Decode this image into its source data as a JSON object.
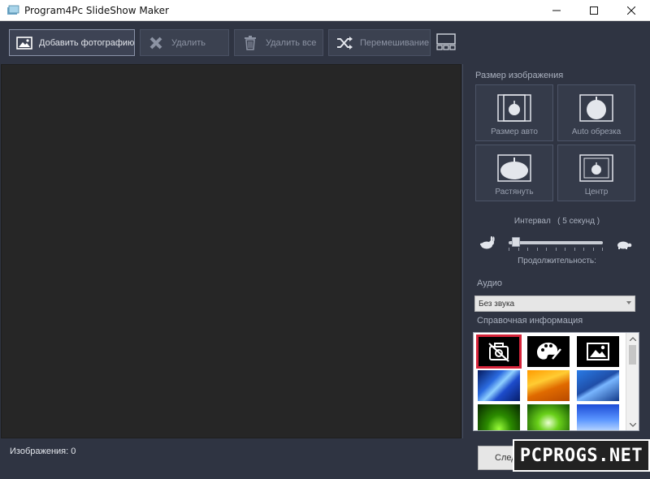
{
  "window": {
    "title": "Program4Pc SlideShow Maker"
  },
  "toolbar": {
    "add_photo": "Добавить фотографию",
    "delete": "Удалить",
    "delete_all": "Удалить все",
    "shuffle": "Перемешивание"
  },
  "panel": {
    "image_size_label": "Размер изображения",
    "size_buttons": [
      {
        "label": "Размер авто"
      },
      {
        "label": "Auto обрезка"
      },
      {
        "label": "Растянуть"
      },
      {
        "label": "Центр"
      }
    ],
    "interval_label": "Интервал",
    "interval_value": "( 5 секунд )",
    "duration_label": "Продолжительность:",
    "slider_level_fraction": 0.08,
    "audio_label": "Аудио",
    "audio_selected": "Без звука",
    "reference_label": "Справочная информация"
  },
  "gallery": {
    "items": [
      {
        "name": "no-image"
      },
      {
        "name": "palette"
      },
      {
        "name": "picture"
      },
      {
        "name": "blue-waves"
      },
      {
        "name": "orange-waves"
      },
      {
        "name": "blue-gradient"
      },
      {
        "name": "green-burst"
      },
      {
        "name": "green-light"
      },
      {
        "name": "sky-blue"
      }
    ]
  },
  "status": {
    "images_count_label": "Изображения: 0",
    "next_button": "Следующий"
  },
  "watermark": {
    "text": "PCPROGS.NET"
  },
  "colors": {
    "window_bg": "#2f3442",
    "preview_bg": "#262626",
    "selection": "#d6243a"
  }
}
